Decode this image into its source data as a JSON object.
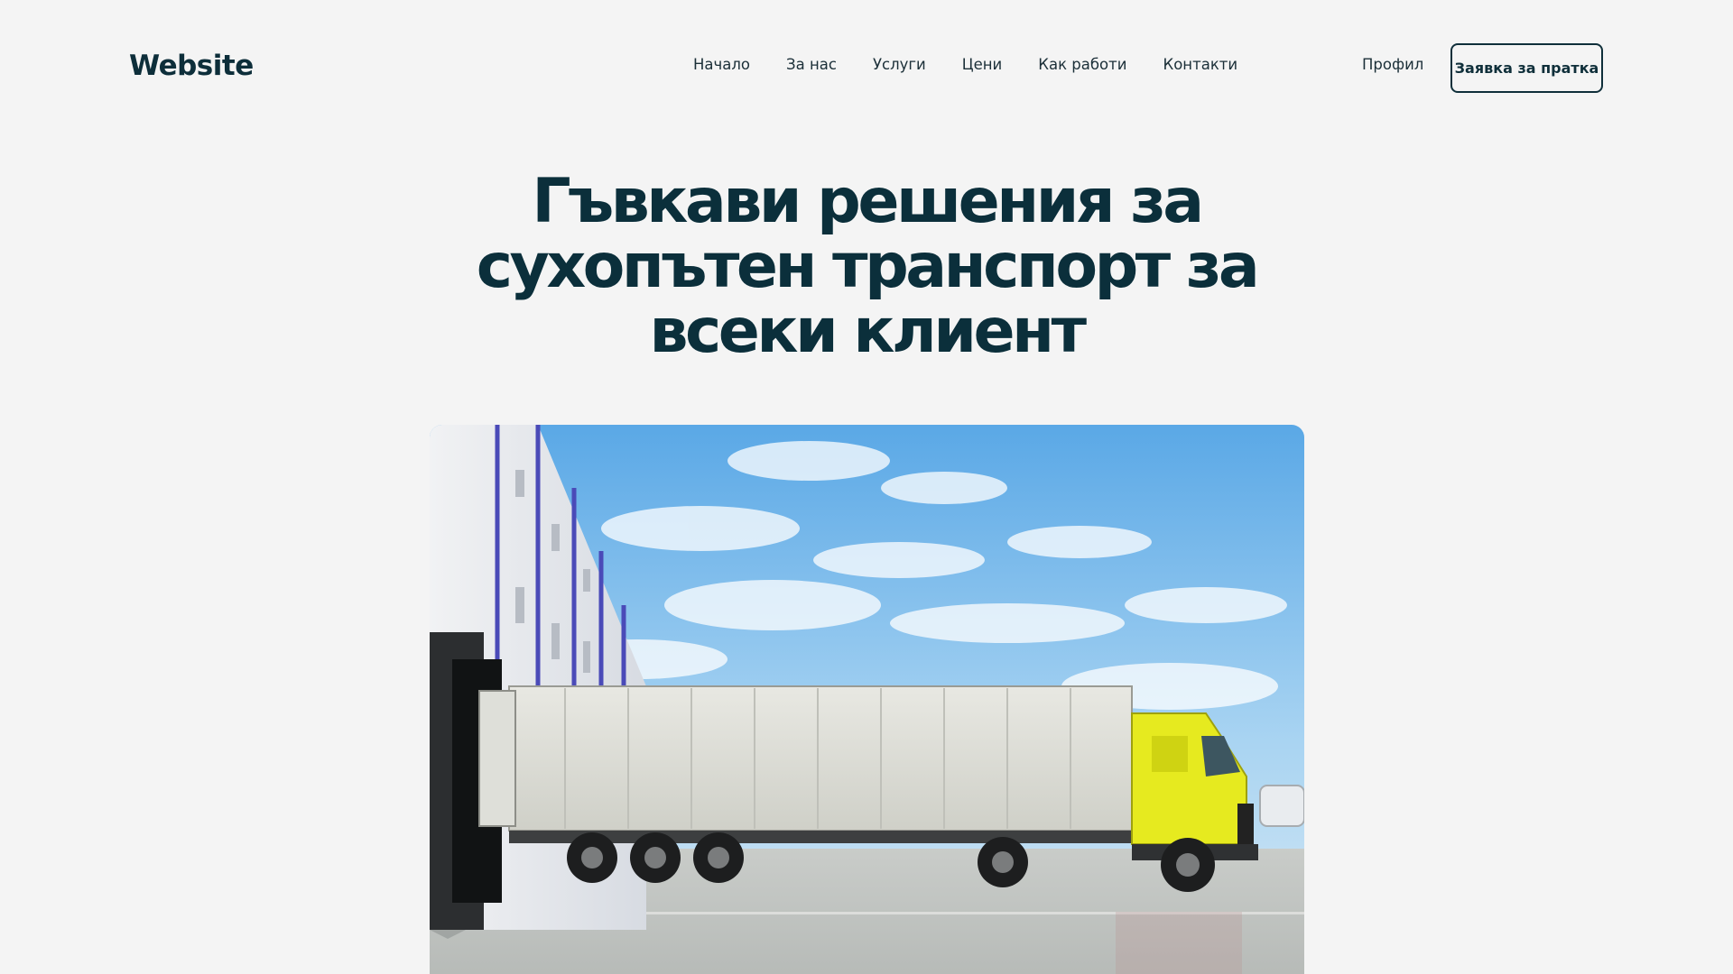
{
  "header": {
    "logo": "Website",
    "nav": [
      {
        "label": "Начало"
      },
      {
        "label": "За нас"
      },
      {
        "label": "Услуги"
      },
      {
        "label": "Цени"
      },
      {
        "label": "Как работи"
      },
      {
        "label": "Контакти"
      }
    ],
    "profile_label": "Профил",
    "cta_label": "Заявка за пратка"
  },
  "hero": {
    "title_line1": "Гъвкави решения за",
    "title_line2": "сухопътен транспорт за",
    "title_line3": "всеки клиент",
    "image_alt": "Бял камион с жълта кабина пред склад"
  },
  "colors": {
    "background": "#f4f4f4",
    "primary_text": "#0b2f3b",
    "truck_cab": "#e6ea1f"
  }
}
